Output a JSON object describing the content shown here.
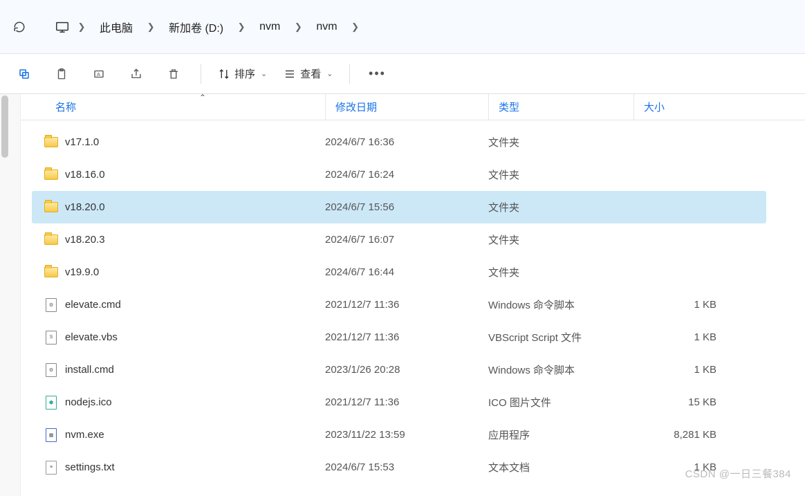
{
  "breadcrumb": {
    "items": [
      "此电脑",
      "新加卷 (D:)",
      "nvm",
      "nvm"
    ]
  },
  "toolbar": {
    "sort_label": "排序",
    "view_label": "查看"
  },
  "columns": {
    "name": "名称",
    "date": "修改日期",
    "type": "类型",
    "size": "大小"
  },
  "files": [
    {
      "icon": "folder",
      "name": "v17.1.0",
      "date": "2024/6/7 16:36",
      "type": "文件夹",
      "size": "",
      "selected": false
    },
    {
      "icon": "folder",
      "name": "v18.16.0",
      "date": "2024/6/7 16:24",
      "type": "文件夹",
      "size": "",
      "selected": false
    },
    {
      "icon": "folder",
      "name": "v18.20.0",
      "date": "2024/6/7 15:56",
      "type": "文件夹",
      "size": "",
      "selected": true
    },
    {
      "icon": "folder",
      "name": "v18.20.3",
      "date": "2024/6/7 16:07",
      "type": "文件夹",
      "size": "",
      "selected": false
    },
    {
      "icon": "folder",
      "name": "v19.9.0",
      "date": "2024/6/7 16:44",
      "type": "文件夹",
      "size": "",
      "selected": false
    },
    {
      "icon": "cmd",
      "name": "elevate.cmd",
      "date": "2021/12/7 11:36",
      "type": "Windows 命令脚本",
      "size": "1 KB",
      "selected": false
    },
    {
      "icon": "vbs",
      "name": "elevate.vbs",
      "date": "2021/12/7 11:36",
      "type": "VBScript Script 文件",
      "size": "1 KB",
      "selected": false
    },
    {
      "icon": "cmd",
      "name": "install.cmd",
      "date": "2023/1/26 20:28",
      "type": "Windows 命令脚本",
      "size": "1 KB",
      "selected": false
    },
    {
      "icon": "ico",
      "name": "nodejs.ico",
      "date": "2021/12/7 11:36",
      "type": "ICO 图片文件",
      "size": "15 KB",
      "selected": false
    },
    {
      "icon": "exe",
      "name": "nvm.exe",
      "date": "2023/11/22 13:59",
      "type": "应用程序",
      "size": "8,281 KB",
      "selected": false
    },
    {
      "icon": "txt",
      "name": "settings.txt",
      "date": "2024/6/7 15:53",
      "type": "文本文档",
      "size": "1 KB",
      "selected": false
    }
  ],
  "watermark": "CSDN @一日三餐384"
}
